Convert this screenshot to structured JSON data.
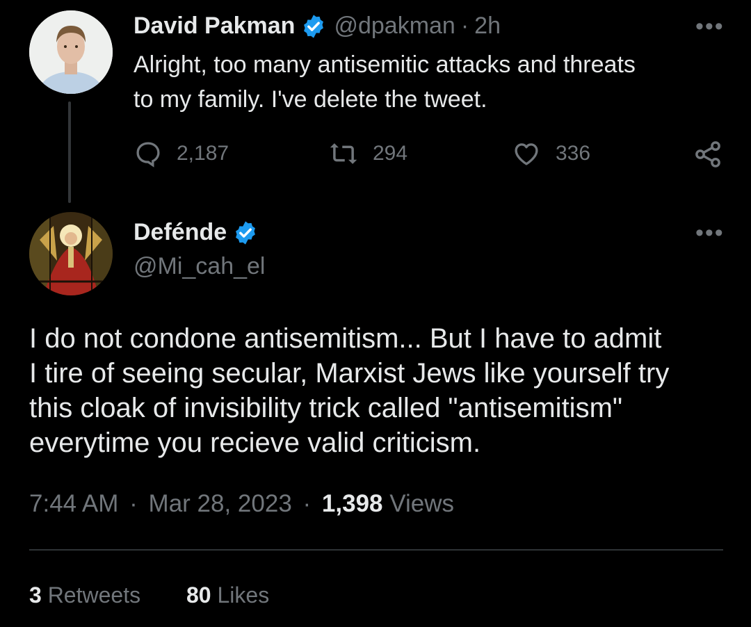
{
  "reply_tweet": {
    "name": "David Pakman",
    "handle": "@dpakman",
    "separator": "·",
    "time": "2h",
    "more": "•••",
    "text_line1": "Alright, too many antisemitic attacks and threats",
    "text_line2": "to my family. I've delete the tweet.",
    "replies": "2,187",
    "retweets": "294",
    "likes": "336"
  },
  "main_tweet": {
    "name": "Defénde",
    "handle": "@Mi_cah_el",
    "more": "•••",
    "text_lines": [
      "I do not condone antisemitism... But I have to admit",
      "I tire of seeing secular, Marxist Jews like yourself try",
      "this cloak of invisibility trick called \"antisemitism\"",
      "everytime you recieve valid criticism."
    ],
    "time": "7:44 AM",
    "sep1": "·",
    "date": "Mar 28, 2023",
    "sep2": "·",
    "views_count": "1,398",
    "views_label": "Views",
    "retweets_count": "3",
    "retweets_label": "Retweets",
    "likes_count": "80",
    "likes_label": "Likes"
  },
  "colors": {
    "background": "#000000",
    "text": "#e7e9ea",
    "muted": "#71767b",
    "verified": "#1d9bf0",
    "divider": "#2f3336"
  },
  "icons": [
    "verified-badge-icon",
    "reply-icon",
    "retweet-icon",
    "like-icon",
    "share-icon",
    "more-icon"
  ]
}
